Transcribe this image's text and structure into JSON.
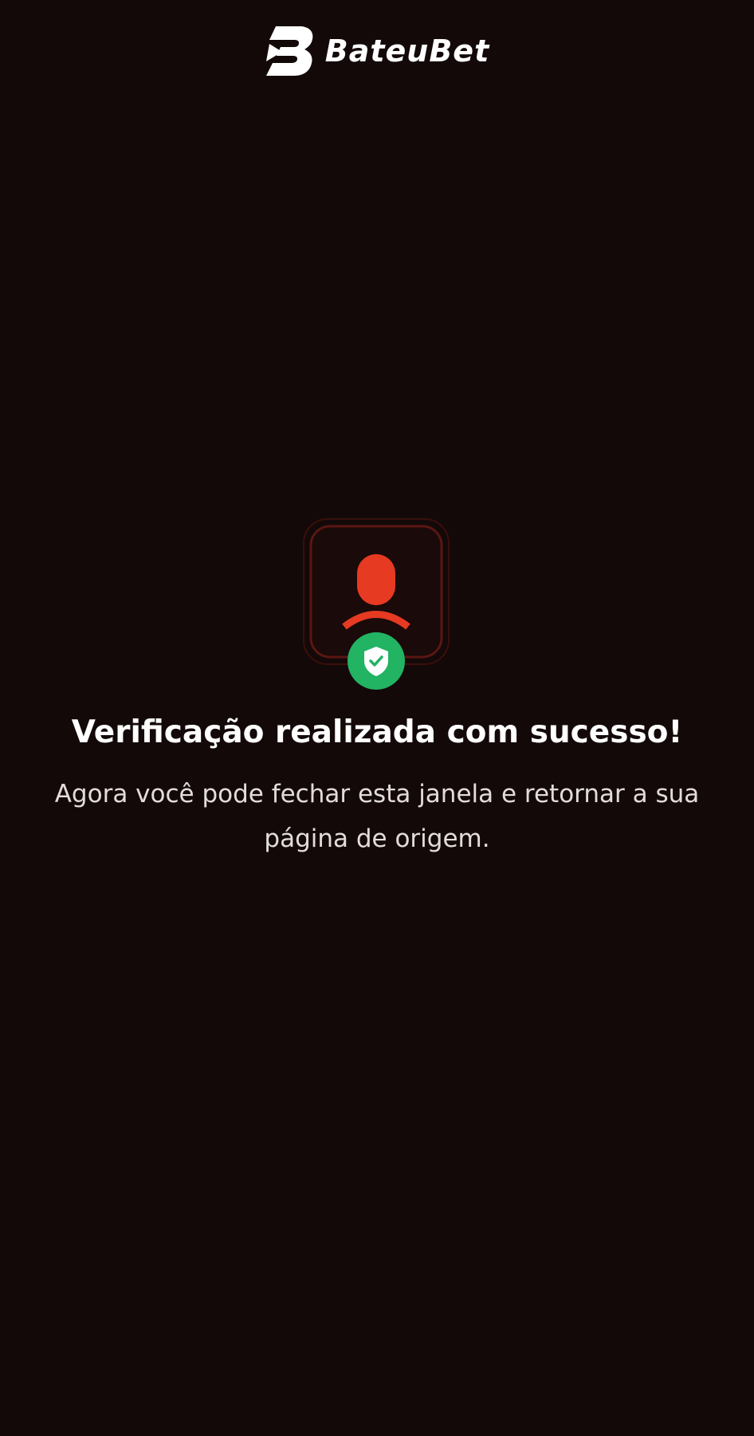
{
  "brand": {
    "name": "BateuBet",
    "logo_icon": "bateubet-b-logo-icon"
  },
  "illustration": {
    "user_icon": "user-silhouette-icon",
    "badge_icon": "shield-check-icon"
  },
  "colors": {
    "background": "#140909",
    "accent_red": "#e63a22",
    "frame_red": "#4a1410",
    "success_green": "#22b363",
    "text_primary": "#ffffff",
    "text_secondary": "#e2dcdc"
  },
  "content": {
    "title": "Verificação realizada com sucesso!",
    "message": "Agora você pode fechar esta janela e retornar a sua página de origem."
  }
}
